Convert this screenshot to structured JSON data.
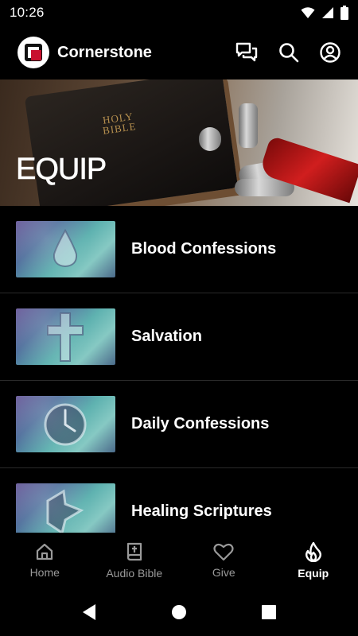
{
  "status_bar": {
    "time": "10:26"
  },
  "header": {
    "app_name": "Cornerstone",
    "icons": [
      "chat-icon",
      "search-icon",
      "account-icon"
    ]
  },
  "hero": {
    "title": "EQUIP",
    "book_text": "HOLY BIBLE"
  },
  "list": {
    "items": [
      {
        "label": "Blood Confessions",
        "icon": "blood-drop"
      },
      {
        "label": "Salvation",
        "icon": "cross"
      },
      {
        "label": "Daily Confessions",
        "icon": "clock"
      },
      {
        "label": "Healing Scriptures",
        "icon": "medical-cross"
      }
    ]
  },
  "bottom_nav": {
    "items": [
      {
        "label": "Home",
        "icon": "home-icon",
        "active": false
      },
      {
        "label": "Audio Bible",
        "icon": "bible-icon",
        "active": false
      },
      {
        "label": "Give",
        "icon": "heart-icon",
        "active": false
      },
      {
        "label": "Equip",
        "icon": "flame-icon",
        "active": true
      }
    ]
  },
  "colors": {
    "background": "#000000",
    "accent_red": "#c8102e",
    "inactive_nav": "#9a9a9a"
  }
}
